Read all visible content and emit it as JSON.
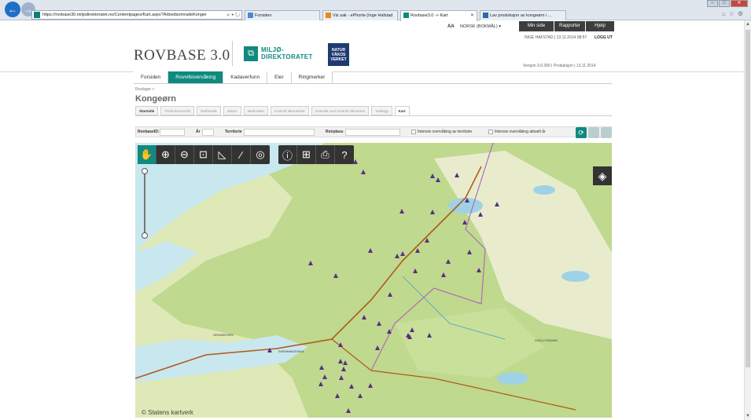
{
  "browser": {
    "address": "https://rovbase30.miljodirektoratet.no/Contentpages/Kart.aspx?ArbeidsomradeKonger",
    "tabs": [
      {
        "label": "Forsiden",
        "color": "#4a8ad1"
      },
      {
        "label": "Vis sak - ePhorte (Inge Hafstad",
        "color": "#e88a1a"
      },
      {
        "label": "Rovbase3.0 -> Kart",
        "color": "#0f8a7e"
      },
      {
        "label": "Lav produksjon av kongeørn i ...",
        "color": "#2a6aa8"
      }
    ],
    "back_icon": "back-arrow-icon",
    "window_controls": [
      "–",
      "□",
      "✕"
    ]
  },
  "header": {
    "text_size": "AA",
    "language": "NORSK (BOKMÅL) ▾",
    "buttons": [
      "Min side",
      "Rapporter",
      "Hjelp"
    ],
    "user": "INGE HAFSTAD | 13.11.2014 08:57",
    "logout": "LOGG UT",
    "brand": "ROVBASE 3.0",
    "md_logo_line1": "MILJØ-",
    "md_logo_line2": "DIREKTORATET",
    "nv_logo_line1": "NATUR",
    "nv_logo_line2": "VÅKOS",
    "nv_logo_line3": "VERKET",
    "version": "Versjon 3.0.390 | Produksjon | 13.11.2014"
  },
  "menu": {
    "items": [
      "Forsiden",
      "Rovviltovervåking",
      "Kadaverfunn",
      "Eier",
      "Ringmerker"
    ],
    "active_index": 1
  },
  "page": {
    "breadcrumb": "Rovlager »",
    "title": "Kongeørn",
    "subtabs": [
      "Startside",
      "Territorieoversikt",
      "Reirbesøk",
      "Status",
      "Merknader",
      "Kontroll alternativer",
      "Oversikt over kontroll elementer",
      "Vedlegg",
      "Kart"
    ],
    "active_subtab": "Kart"
  },
  "filter": {
    "rovbase_label": "RovbaseID:",
    "year_label": "År",
    "territory_label": "Territorie",
    "nest_label": "Reirplass",
    "intensive_label": "Intensiv overvåking av territorie",
    "intensive_current_label": "Intensiv overvåking aktuelt år"
  },
  "map": {
    "attribution": "© Statens kartverk",
    "tools": [
      "pan-hand-icon",
      "zoom-in-icon",
      "zoom-out-icon",
      "zoom-box-icon",
      "measure-angle-icon",
      "measure-line-icon",
      "center-target-icon"
    ],
    "tools2": [
      "info-point-icon",
      "info-area-icon",
      "print-icon",
      "help-icon"
    ],
    "place_names": [
      "GRUNDFORS",
      "SVENNINGSVIKA",
      "GJELLSTADVIK"
    ]
  }
}
